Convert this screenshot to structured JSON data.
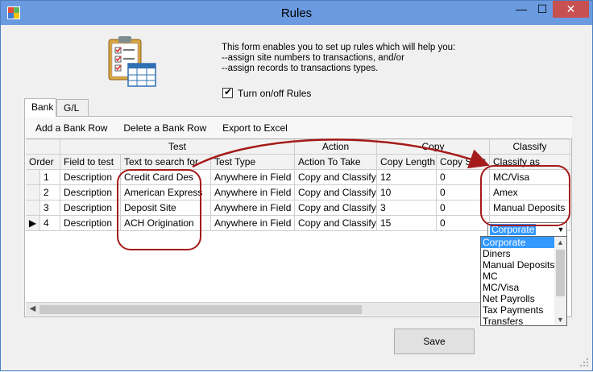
{
  "window": {
    "title": "Rules",
    "controls": [
      "min",
      "max",
      "close"
    ]
  },
  "intro": {
    "line1": "This form enables you to set up rules which will help you:",
    "line2": "--assign site numbers to transactions, and/or",
    "line3": "--assign records to transactions types."
  },
  "toggle": {
    "label": "Turn on/off Rules",
    "checked": true
  },
  "tabs": [
    {
      "label": "Bank",
      "active": true
    },
    {
      "label": "G/L",
      "active": false
    }
  ],
  "toolbar": {
    "add_row": "Add a Bank Row",
    "delete_row": "Delete a Bank Row",
    "export": "Export to Excel"
  },
  "grid": {
    "group_headers": [
      "Test",
      "Action",
      "Copy",
      "Classify"
    ],
    "columns": [
      "Order",
      "Field to test",
      "Text to search for",
      "Test Type",
      "Action To Take",
      "Copy Length",
      "Copy Start",
      "Classify as"
    ],
    "rows": [
      [
        "1",
        "Description",
        "Credit Card Des",
        "Anywhere in Field",
        "Copy and Classify",
        "12",
        "0",
        "MC/Visa"
      ],
      [
        "2",
        "Description",
        "American Express",
        "Anywhere in Field",
        "Copy and Classify",
        "10",
        "0",
        "Amex"
      ],
      [
        "3",
        "Description",
        "Deposit Site",
        "Anywhere in Field",
        "Copy and Classify",
        "3",
        "0",
        "Manual Deposits"
      ],
      [
        "4",
        "Description",
        "ACH Origination",
        "Anywhere in Field",
        "Copy and Classify",
        "15",
        "0",
        "Corporate"
      ]
    ],
    "current_row_marker": "▶"
  },
  "classify_dropdown": {
    "selected": "Corporate",
    "options": [
      "Corporate",
      "Diners",
      "Manual Deposits",
      "MC",
      "MC/Visa",
      "Net Payrolls",
      "Tax Payments",
      "Transfers"
    ]
  },
  "save_label": "Save",
  "colors": {
    "accent": "#3399ff",
    "annotation": "#a51a1a",
    "title_bar": "#6a9ae0",
    "close_button": "#c75050"
  }
}
